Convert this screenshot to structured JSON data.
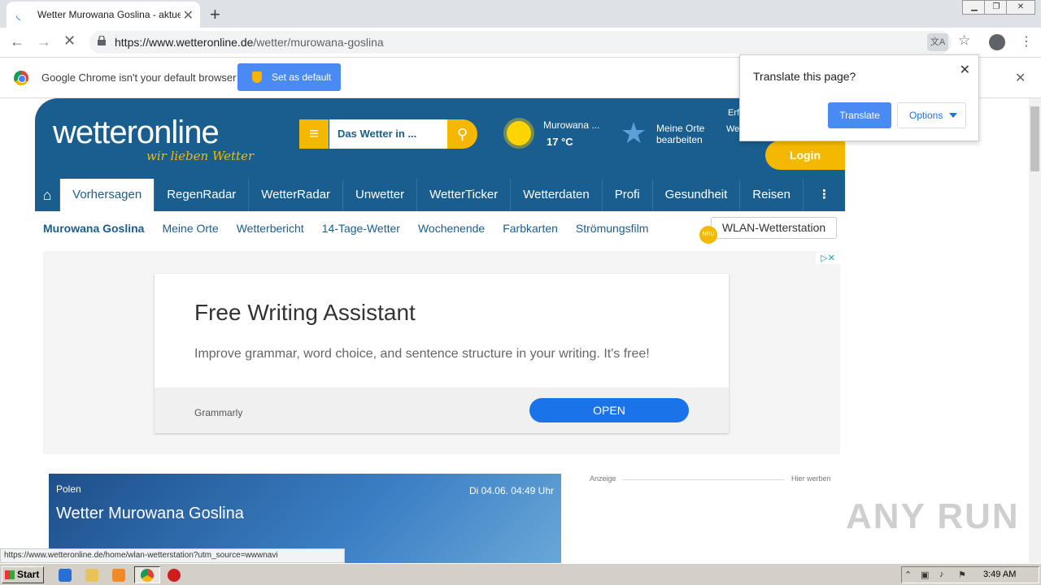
{
  "browser": {
    "tab_title": "Wetter Murowana Goslina - aktuelle",
    "url_host": "https://www.wetteronline.de",
    "url_path": "/wetter/murowana-goslina"
  },
  "infobar": {
    "message": "Google Chrome isn't your default browser",
    "set_default_label": "Set as default"
  },
  "translate_popup": {
    "title": "Translate this page?",
    "translate_label": "Translate",
    "options_label": "Options"
  },
  "site": {
    "logo_main": "wetteronline",
    "logo_sub": "wir lieben Wetter",
    "search_placeholder": "Das Wetter in ...",
    "weather_place": "Murowana ...",
    "weather_temp": "17 °C",
    "my_places": "Meine Orte bearbeiten",
    "header_cut1": "Erf",
    "header_cut2": "Wet",
    "login_label": "Login",
    "nav": [
      "Vorhersagen",
      "RegenRadar",
      "WetterRadar",
      "Unwetter",
      "WetterTicker",
      "Wetterdaten",
      "Profi",
      "Gesundheit",
      "Reisen"
    ],
    "subnav": [
      "Murowana Goslina",
      "Meine Orte",
      "Wetterbericht",
      "14-Tage-Wetter",
      "Wochenende",
      "Farbkarten",
      "Strömungsfilm"
    ],
    "wlan_label": "WLAN-Wetterstation",
    "neu_badge": "NEU"
  },
  "ad": {
    "title": "Free Writing Assistant",
    "text": "Improve grammar, word choice, and sentence structure in your writing. It's free!",
    "brand": "Grammarly",
    "open_label": "OPEN"
  },
  "hero": {
    "country": "Polen",
    "date": "Di 04.06. 04:49 Uhr",
    "title": "Wetter Murowana Goslina"
  },
  "sidebar_ad": {
    "label": "Anzeige",
    "hier_werben": "Hier werben"
  },
  "watermark": "ANY RUN",
  "status_url": "https://www.wetteronline.de/home/wlan-wetterstation?utm_source=wwwnavi",
  "taskbar": {
    "start_label": "Start",
    "clock": "3:49 AM"
  }
}
